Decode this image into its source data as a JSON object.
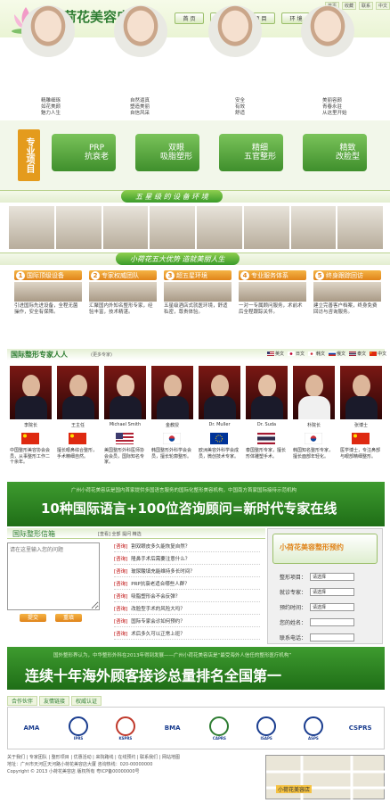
{
  "header": {
    "logo_text": "小荷花美容店",
    "nav": [
      "首 页",
      "专 家",
      "项 目",
      "环 境",
      "联 系"
    ],
    "top_links": [
      "首页",
      "收藏",
      "联系",
      "中文"
    ]
  },
  "models": [
    {
      "lines": [
        "精雕细琢",
        "如花美颜",
        "魅力人生"
      ]
    },
    {
      "lines": [
        "自然逼真",
        "塑造美丽",
        "自信风采"
      ]
    },
    {
      "lines": [
        "安全",
        "有效",
        "舒适"
      ]
    },
    {
      "lines": [
        "美丽容颜",
        "青春永驻",
        "从这里开始"
      ]
    }
  ],
  "projects": {
    "label": "专业项目",
    "items": [
      "PRP\n抗衰老",
      "双眼\n吸脂塑形",
      "精细\n五官整形",
      "精致\n改脸型"
    ]
  },
  "sections": {
    "env_title": "五 星 级 的 设 备 环 境",
    "adv_title": "小荷花五大优势  造就美丽人生"
  },
  "advantages": [
    {
      "num": "1",
      "title": "国际顶级设备",
      "text": "引进国际先进设备，全程无菌操作，安全有保障。"
    },
    {
      "num": "2",
      "title": "专家权威团队",
      "text": "汇聚国内外知名整形专家，经验丰富，技术精湛。"
    },
    {
      "num": "3",
      "title": "超五星环境",
      "text": "五星级酒店式就医环境，舒适私密，尊贵体验。"
    },
    {
      "num": "4",
      "title": "专业服务体系",
      "text": "一对一专属顾问服务，术前术后全程跟踪关怀。"
    },
    {
      "num": "5",
      "title": "终身跟踪回访",
      "text": "建立完善客户档案，终身免费回访与咨询服务。"
    }
  ],
  "experts": {
    "title": "国际整形专家人人",
    "subtitle": "(更多专家)",
    "languages": [
      "英文",
      "日文",
      "韩文",
      "俄文",
      "泰文",
      "中文"
    ],
    "people": [
      {
        "name": "李院长",
        "flag": "cn",
        "desc": "中国整形美容协会会员，从事整形工作二十余年。"
      },
      {
        "name": "王主任",
        "flag": "cn",
        "desc": "擅长眼鼻综合整形，手术精细自然。"
      },
      {
        "name": "Michael Smith",
        "flag": "us",
        "desc": "美国整形外科医师协会会员，国际知名专家。"
      },
      {
        "name": "金教授",
        "flag": "kr",
        "desc": "韩国整形外科学会会员，擅长轮廓整形。"
      },
      {
        "name": "Dr. Muller",
        "flag": "eu",
        "desc": "欧洲美容外科学会成员，微创技术专家。"
      },
      {
        "name": "Dr. Suda",
        "flag": "th",
        "desc": "泰国整形专家，擅长形体雕塑手术。"
      },
      {
        "name": "朴院长",
        "flag": "kr",
        "desc": "韩国知名整形专家，擅长面部年轻化。"
      },
      {
        "name": "张博士",
        "flag": "cn",
        "desc": "医学博士，专注鼻部与眼部精细整形。"
      }
    ]
  },
  "banner_a": {
    "sub": "广州小荷花美容店是国内首家提供多国语言服务的国际化整形美容机构，中国南方首家国际接待示范机构",
    "main": "10种国际语言+100位咨询顾问=新时代专家在线"
  },
  "form": {
    "title": "国际整形信箱",
    "sub": "[查看] 全部  提问  精选",
    "textarea_placeholder": "请在这里输入您的问题",
    "submit": "提交",
    "reset": "重填",
    "questions": [
      {
        "tag": "[咨询]",
        "text": "割双眼皮多久能恢复自然？"
      },
      {
        "tag": "[咨询]",
        "text": "隆鼻手术后需要注意什么？"
      },
      {
        "tag": "[咨询]",
        "text": "玻尿酸填充能维持多长时间？"
      },
      {
        "tag": "[咨询]",
        "text": "PRP抗衰老适合哪些人群？"
      },
      {
        "tag": "[咨询]",
        "text": "吸脂塑形会不会反弹？"
      },
      {
        "tag": "[咨询]",
        "text": "改脸型手术的风险大吗？"
      },
      {
        "tag": "[咨询]",
        "text": "国际专家会诊如何预约？"
      },
      {
        "tag": "[咨询]",
        "text": "术后多久可以正常上班？"
      }
    ]
  },
  "appointment": {
    "title": "小荷花美容整形预约",
    "fields": [
      {
        "label": "整形项目：",
        "value": "请选择"
      },
      {
        "label": "就诊专家：",
        "value": "请选择"
      },
      {
        "label": "预约时间：",
        "value": "请选择"
      },
      {
        "label": "您的姓名：",
        "value": ""
      },
      {
        "label": "联系电话：",
        "value": ""
      }
    ]
  },
  "banner_b": {
    "sub": "国外整形界认为，中华整形外科在2013年得到发展——广州小荷花美容店是“最受海外人信任的整形医疗机构”",
    "main": "连续十年海外顾客接诊总量排名全国第一"
  },
  "partners": {
    "tabs": [
      "合作伙伴",
      "友情链接",
      "权威认证"
    ],
    "logos": [
      "AMA",
      "IPRS",
      "KSPRS",
      "BMA",
      "CAPRS",
      "ISAPS",
      "ASPS",
      "CSPRS"
    ]
  },
  "footer": {
    "links": "关于我们 | 专家团队 | 整形项目 | 优惠活动 | 来院路线 | 在线预约 | 联系我们 | 网站地图",
    "address": "地址：广州市天河区天河路小荷花美容店大厦  咨询热线：020-00000000",
    "copyright": "Copyright © 2013 小荷花美容店 版权所有  粤ICP备00000000号"
  },
  "map": {
    "label": "小荷花美容店"
  },
  "colors": {
    "brand_green": "#3e9b2f",
    "accent_orange": "#e0841a"
  }
}
